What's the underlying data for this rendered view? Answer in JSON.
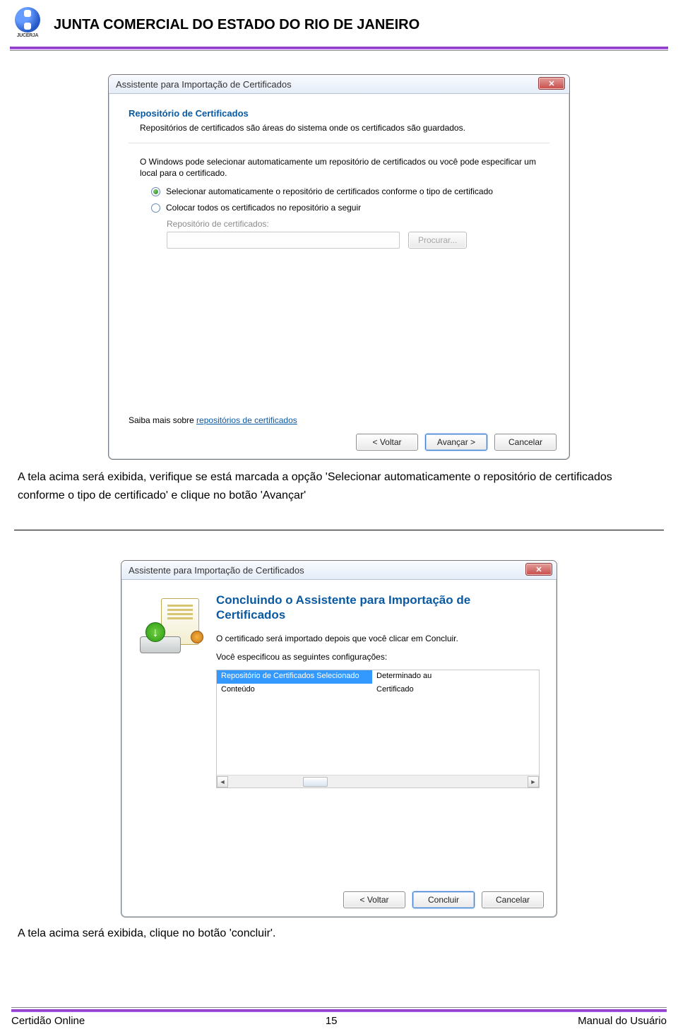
{
  "header": {
    "logo_caption": "JUCERJA",
    "title": "JUNTA COMERCIAL DO ESTADO DO RIO DE JANEIRO"
  },
  "dialog1": {
    "title": "Assistente para Importação de Certificados",
    "section_title": "Repositório de Certificados",
    "section_sub": "Repositórios de certificados são áreas do sistema onde os certificados são guardados.",
    "para1": "O Windows pode selecionar automaticamente um repositório de certificados ou você pode especificar um local para o certificado.",
    "radio1": "Selecionar automaticamente o repositório de certificados conforme o tipo de certificado",
    "radio2": "Colocar todos os certificados no repositório a seguir",
    "repo_label": "Repositório de certificados:",
    "browse_btn": "Procurar...",
    "learn_prefix": "Saiba mais sobre ",
    "learn_link": "repositórios de certificados",
    "btn_back": "< Voltar",
    "btn_next": "Avançar >",
    "btn_cancel": "Cancelar"
  },
  "body_text1": "A tela acima será exibida, verifique se está marcada a opção 'Selecionar automaticamente o repositório de certificados conforme o tipo de certificado' e clique no botão 'Avançar'",
  "dialog2": {
    "title": "Assistente para Importação de Certificados",
    "big_title": "Concluindo o Assistente para Importação de Certificados",
    "para1": "O certificado será importado depois que você clicar em Concluir.",
    "para2": "Você especificou as seguintes configurações:",
    "tbl_h1": "Repositório de Certificados Selecionado",
    "tbl_h2": "Determinado au",
    "tbl_r1c1": "Conteúdo",
    "tbl_r1c2": "Certificado",
    "btn_back": "< Voltar",
    "btn_finish": "Concluir",
    "btn_cancel": "Cancelar"
  },
  "body_text2": "A tela acima será exibida, clique no botão 'concluir'.",
  "footer": {
    "left": "Certidão Online",
    "center": "15",
    "right": "Manual do Usuário"
  }
}
